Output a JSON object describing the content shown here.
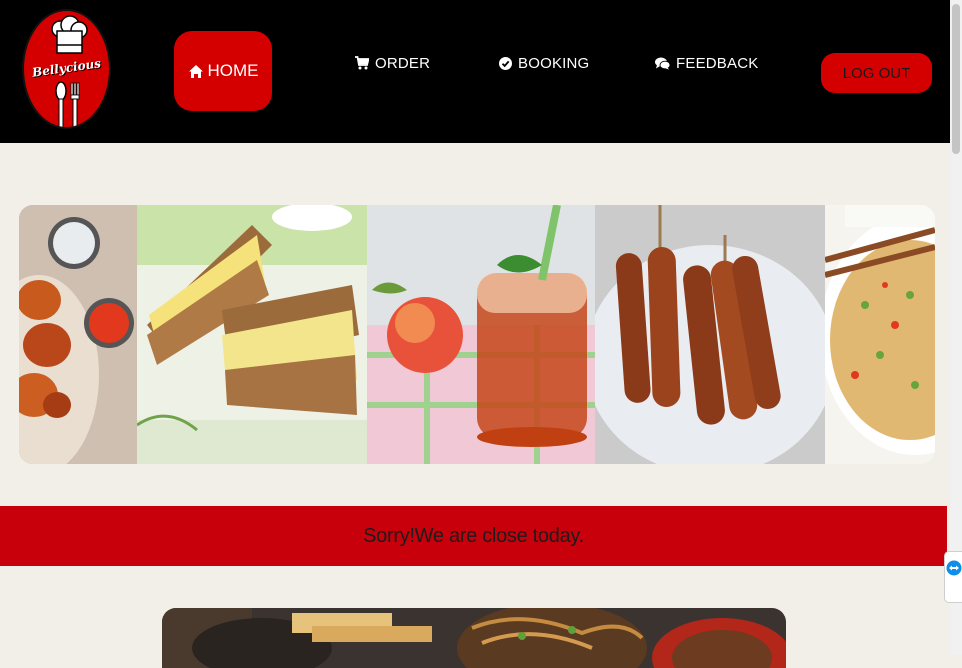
{
  "brand": {
    "name": "Bellycious"
  },
  "nav": {
    "home": "HOME",
    "order": "ORDER",
    "booking": "BOOKING",
    "feedback": "FEEDBACK",
    "logout": "LOG OUT"
  },
  "icons": {
    "home": "home-icon",
    "order": "cart-icon",
    "booking": "check-circle-icon",
    "feedback": "chat-icon"
  },
  "slider": {
    "slides": [
      "fried-wings-with-dips",
      "egg-sandwich",
      "peach-iced-tea",
      "sausage-skewers",
      "fried-rice"
    ]
  },
  "notice": {
    "text": "Sorry!We are close today."
  },
  "colors": {
    "accent": "#d40000",
    "banner": "#c8000c",
    "navbar": "#000000",
    "background": "#f2efe8"
  }
}
